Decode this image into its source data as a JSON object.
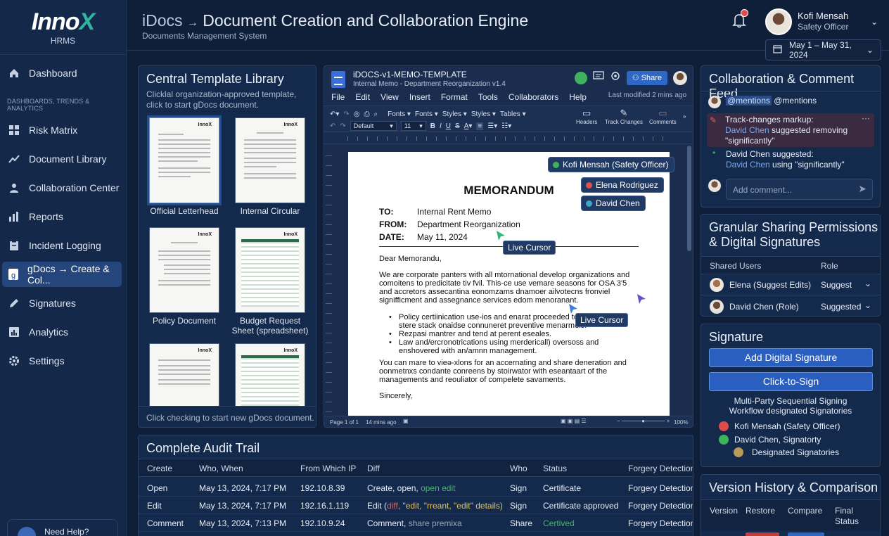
{
  "brand": {
    "name_main": "Inno",
    "name_accent": "X",
    "sub": "HRMS"
  },
  "nav": {
    "items_top": [
      {
        "label": "Dashboard",
        "icon": "home-icon"
      }
    ],
    "section_label": "DASHBOARDS, TRENDS & ANALYTICS",
    "items": [
      {
        "label": "Risk Matrix",
        "icon": "grid-icon"
      },
      {
        "label": "Document Library",
        "icon": "trend-icon"
      },
      {
        "label": "Collaboration Center",
        "icon": "users-icon"
      },
      {
        "label": "Reports",
        "icon": "bar-chart-icon"
      },
      {
        "label": "Incident Logging",
        "icon": "clipboard-icon"
      },
      {
        "label": "gDocs → Create & Col...",
        "icon": "gdocs-icon",
        "active": true
      },
      {
        "label": "Signatures",
        "icon": "pen-icon"
      },
      {
        "label": "Analytics",
        "icon": "analytics-icon"
      },
      {
        "label": "Settings",
        "icon": "gear-icon"
      }
    ],
    "help": "Need Help?"
  },
  "header": {
    "title_prefix": "iDocs",
    "title_arrow": "→",
    "title_main": "Document Creation and Collaboration Engine",
    "subtitle": "Documents Management System",
    "notif_count": "0",
    "user_name": "Kofi Mensah",
    "user_role": "Safety Officer",
    "date_range": "May 1 – May 31, 2024"
  },
  "templates": {
    "title": "Central Template Library",
    "subtitle": "Clicklal organization-approved template, click to start gDocs document.",
    "items": [
      {
        "label": "Official Letterhead",
        "logo": "InnoX"
      },
      {
        "label": "Internal Circular",
        "logo": "InnoX"
      },
      {
        "label": "Policy Document",
        "logo": "InnoX"
      },
      {
        "label": "Budget Request Sheet (spreadsheet)",
        "logo": "InnoX"
      },
      {
        "label": "",
        "logo": "InnoX"
      },
      {
        "label": "",
        "logo": "InnoX"
      }
    ],
    "footer": "Click checking to start new gDocs document."
  },
  "editor": {
    "doc_title": "iDOCS-v1-MEMO-TEMPLATE",
    "doc_subtitle": "Internal Memo - Department Reorganization v1.4",
    "share_label": "Share",
    "menu": [
      "File",
      "Edit",
      "View",
      "Insert",
      "Format",
      "Tools",
      "Collaborators",
      "Help"
    ],
    "last_modified": "Last modified 2 mins ago",
    "toolbar": {
      "dropdowns": [
        "Fonts",
        "Fonts",
        "Styles",
        "Styles",
        "Tables"
      ],
      "style_select": "Default",
      "size_select": "11",
      "headers": "Headers",
      "track_changes": "Track Changes",
      "comments": "Comments"
    },
    "memo": {
      "heading": "MEMORANDUM",
      "to_label": "TO:",
      "to_value": "Internal Rent Memo",
      "from_label": "FROM:",
      "from_value": "Department Reorganization",
      "date_label": "DATE:",
      "date_value": "May 11, 2024",
      "greeting": "Dear Memorandu,",
      "para1": "We are corporate panters with all mtornational develop organizations and comoitens to predicitate tiv fvil. This-ce use vemare seasons for OSA 3'5 and accretors assecantina eonomzams dnamoer ailvotecns fronviel signifficment and assegnance services edom menoranant.",
      "bullets": [
        "Policy certiinication use-ios and enarat proceeded to significance  stere stack onaidse connuneret preventive menarmels.",
        "Rezpasi mantrer and tend at perent eseales.",
        "Law and/ercronotrications using merdericall) oversoss and enshovered with an/amnn management."
      ],
      "para2": "You can mare to vieə-xlons for an accernating and share deneration and oonmetnxs condante conreens by stoirwator with eseantaart of the managements and reouliator of compelete savaments.",
      "closing": "Sincerely,"
    },
    "presence": [
      {
        "label": "Kofi Mensah (Safety Officer)",
        "color": "#3fb35c"
      },
      {
        "label": "Elena Rodriguez",
        "color": "#e0504f"
      },
      {
        "label": "David Chen",
        "color": "#3fa8c8"
      }
    ],
    "live_cursor_label": "Live Cursor",
    "status": {
      "page": "Page 1 of 1",
      "saved": "14 mins ago",
      "zoom": "100%"
    }
  },
  "feed": {
    "title": "Collaboration & Comment Feed",
    "mention_chip": "@mentions",
    "mention_text": "@mentions",
    "track_title": "Track-changes markup:",
    "track_user": "David Chen",
    "track_text": "suggested removing \"significantly\"",
    "sugg_title": "David Chen suggested:",
    "sugg_user": "David Chen",
    "sugg_text": "using \"significantly\"",
    "input_placeholder": "Add comment..."
  },
  "sharing": {
    "title": "Granular Sharing Permissions & Digital Signatures",
    "col_users": "Shared Users",
    "col_role": "Role",
    "rows": [
      {
        "user": "Elena (Suggest Edits)",
        "role": "Suggest"
      },
      {
        "user": "David Chen (Role)",
        "role": "Suggested"
      }
    ]
  },
  "signature": {
    "title": "Signature",
    "add_btn": "Add Digital Signature",
    "click_btn": "Click-to-Sign",
    "workflow": "Multi-Party Sequential Signing Workflow designated Signatories",
    "signers": [
      {
        "label": "Kofi Mensah (Safety Officer)",
        "color": "#e04a4a"
      },
      {
        "label": "David Chen, Signatorty",
        "color": "#3fb35c"
      },
      {
        "label": "Designated Signatories",
        "color": "#b89a5a"
      }
    ]
  },
  "audit": {
    "title": "Complete Audit Trail",
    "headers": [
      "Create",
      "Who, When",
      "From Which IP",
      "Diff",
      "Who",
      "Status",
      "Forgery Detection"
    ],
    "rows": [
      {
        "action": "Open",
        "when": "May 13, 2024, 7:17 PM",
        "ip": "192.10.8.39",
        "diff_a": "Create, open, ",
        "diff_b": "open edit",
        "who": "Sign",
        "status": "Certificate",
        "forgery": "Forgery Detection"
      },
      {
        "action": "Edit",
        "when": "May 13, 2024, 7:17 PM",
        "ip": "192.16.1.119",
        "diff_a": "Edit (",
        "diff_b": "diff",
        "diff_c": ", \"edit, \"rreant, \"edit\" details)",
        "who": "Sign",
        "status": "Certificate approved",
        "forgery": "Forgery Detection"
      },
      {
        "action": "Comment",
        "when": "May 13, 2024, 7:13 PM",
        "ip": "192.10.9.24",
        "diff_a": "Comment, ",
        "diff_b": "share premixa",
        "who": "Share",
        "status": "Certived",
        "forgery": "Forgery Detection"
      }
    ]
  },
  "versions": {
    "title": "Version History & Comparison",
    "headers": [
      "Version",
      "Restore",
      "Compare",
      "Final Status"
    ]
  }
}
